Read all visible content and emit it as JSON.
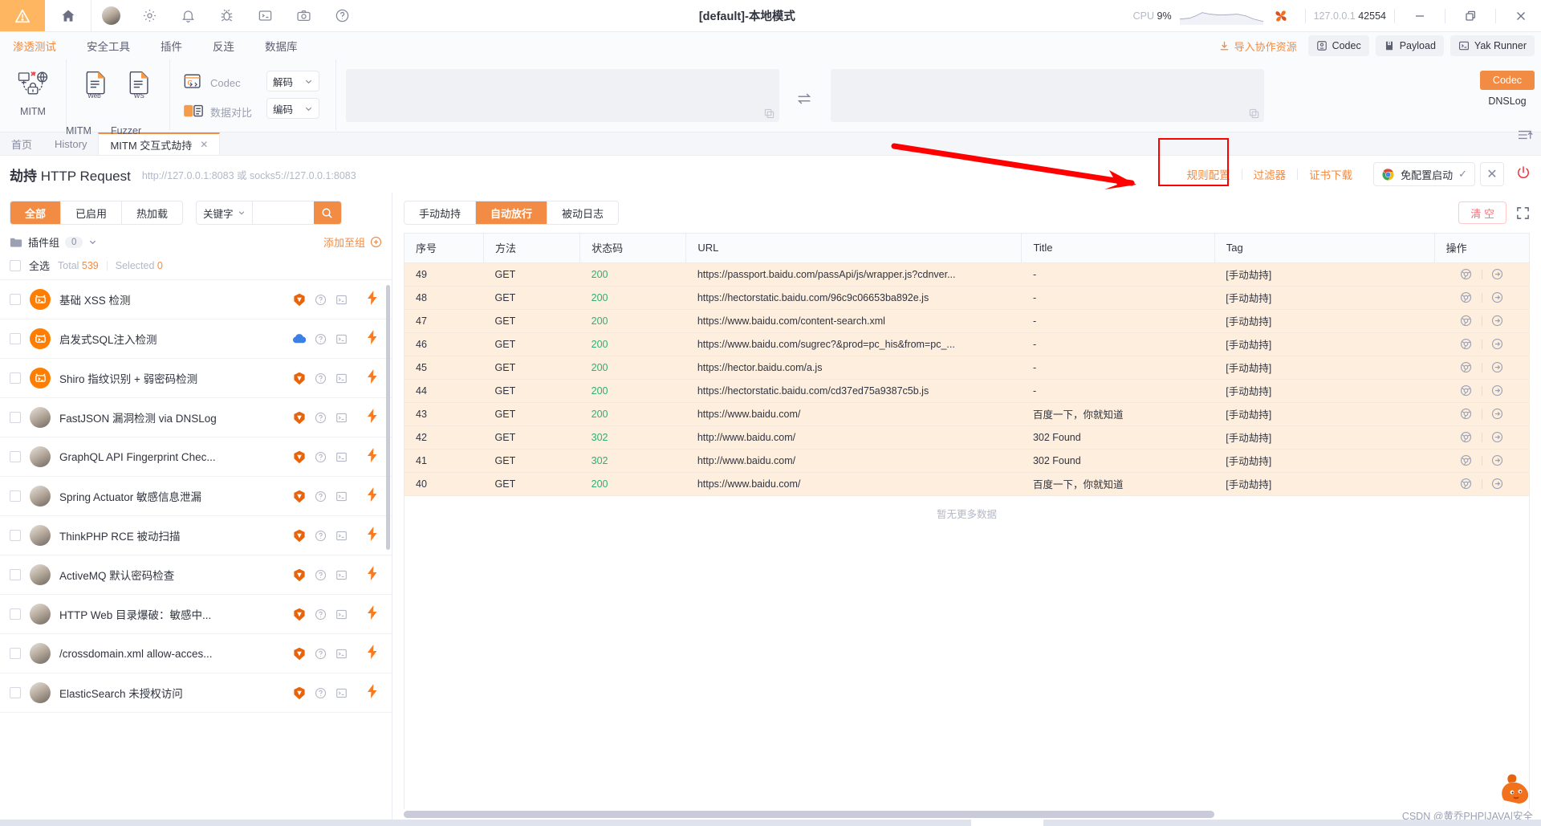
{
  "titlebar": {
    "title": "[default]-本地模式",
    "cpu_label": "CPU",
    "cpu_value": "9%",
    "addr_host": "127.0.0.1",
    "addr_port": "42554"
  },
  "ribbon": {
    "tabs": [
      {
        "label": "渗透测试",
        "active": true
      },
      {
        "label": "安全工具",
        "active": false
      },
      {
        "label": "插件",
        "active": false
      },
      {
        "label": "反连",
        "active": false
      },
      {
        "label": "数据库",
        "active": false
      }
    ],
    "group1": [
      {
        "label": "MITM"
      }
    ],
    "group2": [
      {
        "label": "Fuzzer"
      }
    ],
    "codec_rows": [
      {
        "label": "Codec"
      },
      {
        "label": "数据对比"
      }
    ],
    "selects": [
      {
        "label": "解码"
      },
      {
        "label": "编码"
      }
    ],
    "top_links": [
      {
        "label": "导入协作资源",
        "icon": "import-icon"
      }
    ],
    "top_buttons": [
      {
        "label": "Codec",
        "icon": "codec-icon"
      },
      {
        "label": "Payload",
        "icon": "payload-icon"
      },
      {
        "label": "Yak Runner",
        "icon": "terminal-icon"
      }
    ],
    "side_tabs": [
      {
        "label": "Codec",
        "active": true
      },
      {
        "label": "DNSLog",
        "active": false
      }
    ]
  },
  "tabstrip": {
    "tabs": [
      {
        "label": "首页",
        "active": false,
        "closable": false
      },
      {
        "label": "History",
        "active": false,
        "closable": false
      },
      {
        "label": "MITM 交互式劫持",
        "active": true,
        "closable": true,
        "close": "✕"
      }
    ]
  },
  "page_header": {
    "title_bold": "劫持",
    "title_rest": " HTTP Request",
    "subtitle": "http://127.0.0.1:8083 或 socks5://127.0.0.1:8083",
    "links": [
      {
        "label": "规则配置",
        "highlighted": true
      },
      {
        "label": "过滤器",
        "highlighted": false
      },
      {
        "label": "证书下载",
        "highlighted": false
      }
    ],
    "chip_label": "免配置启动",
    "chip_check": "✓",
    "close_label": "✕"
  },
  "left_panel": {
    "segments": [
      {
        "label": "全部",
        "active": true
      },
      {
        "label": "已启用",
        "active": false
      },
      {
        "label": "热加载",
        "active": false
      }
    ],
    "search": {
      "select_label": "关键字",
      "value": "",
      "placeholder": ""
    },
    "group": {
      "label": "插件组",
      "count": "0",
      "add_label": "添加至组"
    },
    "select_all_label": "全选",
    "total_label": "Total",
    "total_value": "539",
    "selected_label": "Selected",
    "selected_value": "0",
    "plugins": [
      {
        "name": "基础 XSS 检测",
        "avatar": "orange",
        "badge": "shield"
      },
      {
        "name": "启发式SQL注入检测",
        "avatar": "orange",
        "badge": "cloud"
      },
      {
        "name": "Shiro 指纹识别 + 弱密码检测",
        "avatar": "orange",
        "badge": "shield"
      },
      {
        "name": "FastJSON 漏洞检测 via DNSLog",
        "avatar": "photo",
        "badge": "shield"
      },
      {
        "name": "GraphQL API Fingerprint Chec...",
        "avatar": "photo",
        "badge": "shield"
      },
      {
        "name": "Spring Actuator 敏感信息泄漏",
        "avatar": "photo",
        "badge": "shield"
      },
      {
        "name": "ThinkPHP RCE 被动扫描",
        "avatar": "photo",
        "badge": "shield"
      },
      {
        "name": "ActiveMQ 默认密码检查",
        "avatar": "photo",
        "badge": "shield"
      },
      {
        "name": "HTTP Web 目录爆破：敏感中...",
        "avatar": "photo",
        "badge": "shield"
      },
      {
        "name": "/crossdomain.xml allow-acces...",
        "avatar": "photo",
        "badge": "shield"
      },
      {
        "name": "ElasticSearch 未授权访问",
        "avatar": "photo",
        "badge": "shield"
      }
    ]
  },
  "right_panel": {
    "tabs": [
      {
        "label": "手动劫持",
        "active": false
      },
      {
        "label": "自动放行",
        "active": true
      },
      {
        "label": "被动日志",
        "active": false
      }
    ],
    "clear_label": "清 空",
    "columns": [
      "序号",
      "方法",
      "状态码",
      "URL",
      "Title",
      "Tag",
      "操作"
    ],
    "rows": [
      {
        "id": "49",
        "method": "GET",
        "status": "200",
        "url": "https://passport.baidu.com/passApi/js/wrapper.js?cdnver...",
        "title": "-",
        "tag": "[手动劫持]"
      },
      {
        "id": "48",
        "method": "GET",
        "status": "200",
        "url": "https://hectorstatic.baidu.com/96c9c06653ba892e.js",
        "title": "-",
        "tag": "[手动劫持]"
      },
      {
        "id": "47",
        "method": "GET",
        "status": "200",
        "url": "https://www.baidu.com/content-search.xml",
        "title": "-",
        "tag": "[手动劫持]"
      },
      {
        "id": "46",
        "method": "GET",
        "status": "200",
        "url": "https://www.baidu.com/sugrec?&prod=pc_his&from=pc_...",
        "title": "-",
        "tag": "[手动劫持]"
      },
      {
        "id": "45",
        "method": "GET",
        "status": "200",
        "url": "https://hector.baidu.com/a.js",
        "title": "-",
        "tag": "[手动劫持]"
      },
      {
        "id": "44",
        "method": "GET",
        "status": "200",
        "url": "https://hectorstatic.baidu.com/cd37ed75a9387c5b.js",
        "title": "-",
        "tag": "[手动劫持]"
      },
      {
        "id": "43",
        "method": "GET",
        "status": "200",
        "url": "https://www.baidu.com/",
        "title": "百度一下，你就知道",
        "tag": "[手动劫持]"
      },
      {
        "id": "42",
        "method": "GET",
        "status": "302",
        "url": "http://www.baidu.com/",
        "title": "302 Found",
        "tag": "[手动劫持]"
      },
      {
        "id": "41",
        "method": "GET",
        "status": "302",
        "url": "http://www.baidu.com/",
        "title": "302 Found",
        "tag": "[手动劫持]"
      },
      {
        "id": "40",
        "method": "GET",
        "status": "200",
        "url": "https://www.baidu.com/",
        "title": "百度一下，你就知道",
        "tag": "[手动劫持]"
      }
    ],
    "no_more_label": "暂无更多数据"
  },
  "watermark": "CSDN @黄乔PHP|JAVA|安全",
  "colors": {
    "accent": "#f28b44",
    "row_bg": "#fdeede",
    "status_green": "#2fae77",
    "highlight_red": "#ff0000"
  }
}
